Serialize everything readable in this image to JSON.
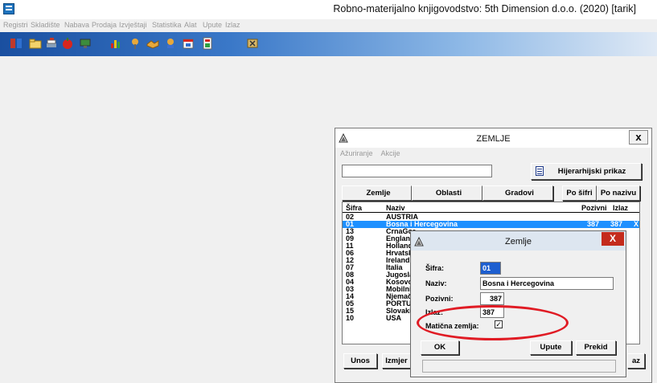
{
  "app": {
    "title": "Robno-materijalno knjigovodstvo: 5th Dimension d.o.o. (2020) [tarik]"
  },
  "menu": [
    "Registri",
    "Skladište",
    "Nabava",
    "Prodaja",
    "Izvještaji",
    "Statistika",
    "Alat",
    "Upute",
    "Izlaz"
  ],
  "toolbar_icons": [
    "registry-icon",
    "folder-icon",
    "stack-icon",
    "apple-icon",
    "screen-icon",
    "chart-icon",
    "pin-icon",
    "handshake-icon",
    "map-pin-icon",
    "calendar-icon",
    "calculator-icon",
    "exit-icon"
  ],
  "zemlje_window": {
    "title": "ZEMLJE",
    "close": "x",
    "menu": [
      "Ažuriranje",
      "Akcije"
    ],
    "search_value": "",
    "hierarchy_button": "Hijerarhijski prikaz",
    "tabs": [
      "Zemlje",
      "Oblasti",
      "Gradovi"
    ],
    "sort_by_code": "Po šifri",
    "sort_by_name": "Po nazivu",
    "columns": {
      "code": "Šifra",
      "name": "Naziv",
      "dial": "Pozivni",
      "exit": "Izlaz"
    },
    "rows": [
      {
        "code": "02",
        "name": "AUSTRIA",
        "dial": "",
        "exit": "",
        "mark": ""
      },
      {
        "code": "01",
        "name": "Bosna i Hercegovina",
        "dial": "387",
        "exit": "387",
        "mark": "X"
      },
      {
        "code": "13",
        "name": "CrnaGor",
        "dial": "",
        "exit": "",
        "mark": ""
      },
      {
        "code": "09",
        "name": "England",
        "dial": "",
        "exit": "",
        "mark": ""
      },
      {
        "code": "11",
        "name": "Holland",
        "dial": "",
        "exit": "",
        "mark": ""
      },
      {
        "code": "06",
        "name": "Hrvatsk",
        "dial": "",
        "exit": "",
        "mark": ""
      },
      {
        "code": "12",
        "name": "Ireland",
        "dial": "",
        "exit": "",
        "mark": ""
      },
      {
        "code": "07",
        "name": "Italia",
        "dial": "",
        "exit": "",
        "mark": ""
      },
      {
        "code": "08",
        "name": "Jugosla",
        "dial": "",
        "exit": "",
        "mark": ""
      },
      {
        "code": "04",
        "name": "Kosovo",
        "dial": "",
        "exit": "",
        "mark": ""
      },
      {
        "code": "03",
        "name": "Mobilni",
        "dial": "",
        "exit": "",
        "mark": ""
      },
      {
        "code": "14",
        "name": "Njemačl",
        "dial": "",
        "exit": "",
        "mark": ""
      },
      {
        "code": "05",
        "name": "PORTU",
        "dial": "",
        "exit": "",
        "mark": ""
      },
      {
        "code": "15",
        "name": "Slovaki",
        "dial": "",
        "exit": "",
        "mark": ""
      },
      {
        "code": "10",
        "name": "USA",
        "dial": "",
        "exit": "",
        "mark": ""
      }
    ],
    "selected_row": 1,
    "btn_unos": "Unos",
    "btn_izmjena": "Izmjer",
    "btn_right": "az"
  },
  "zemlje_dialog": {
    "title": "Zemlje",
    "close": "X",
    "sifra_label": "Šifra:",
    "sifra_value": "01",
    "naziv_label": "Naziv:",
    "naziv_value": "Bosna i Hercegovina",
    "pozivni_label": "Pozivni:",
    "pozivni_value": "387",
    "izlaz_label": "Izlaz:",
    "izlaz_value": "387",
    "maticna_label": "Matična zemlja:",
    "maticna_checked": "✓",
    "ok": "OK",
    "upute": "Upute",
    "prekid": "Prekid"
  }
}
